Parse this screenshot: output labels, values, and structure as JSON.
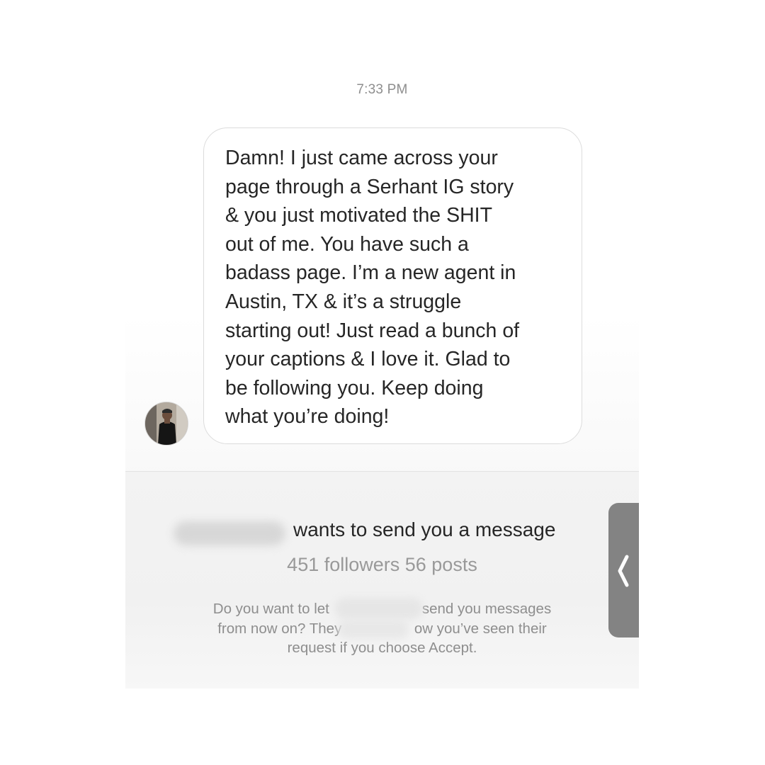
{
  "conversation": {
    "timestamp": "7:33 PM",
    "message": {
      "text": "Damn! I just came across your\npage through a Serhant IG story\n& you just motivated the SHIT\nout of me. You have such a\nbadass page. I’m a new agent in\nAustin, TX & it’s a struggle\nstarting out! Just read a bunch of\nyour captions & I love it. Glad to\nbe following you. Keep doing\nwhat you’re doing!"
    }
  },
  "request": {
    "title": "wants to send you a message",
    "stats": "451 followers 56 posts",
    "description_lines": [
      "Do you want to let                       send you messages",
      "from now on? They                  ow you’ve seen their",
      "request if you choose Accept."
    ]
  },
  "colors": {
    "bubble_border": "#dcdcdc",
    "text_primary": "#262626",
    "text_secondary": "#8e8e8e",
    "panel_background": "#f3f3f3",
    "drawer_handle": "#7a7a7a"
  },
  "icons": {
    "drawer": "chevron-left-icon",
    "avatar": "avatar"
  }
}
